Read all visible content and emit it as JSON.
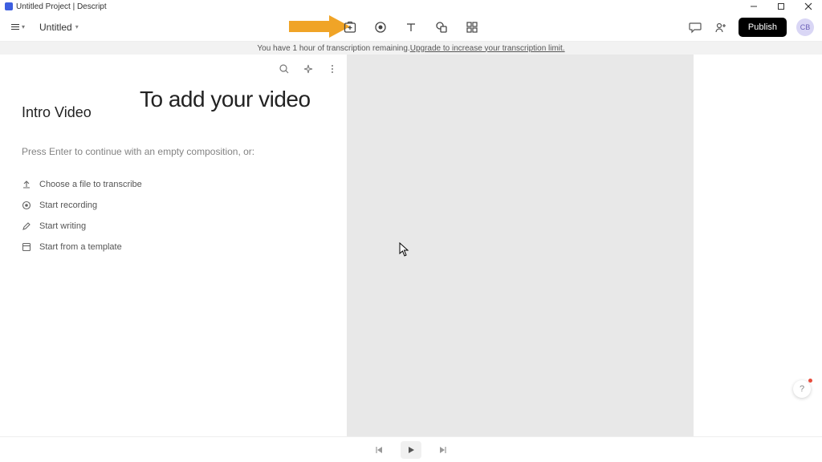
{
  "titlebar": {
    "title": "Untitled Project | Descript"
  },
  "toolbar": {
    "project_name": "Untitled",
    "publish_label": "Publish",
    "avatar_initials": "CB"
  },
  "banner": {
    "text": "You have 1 hour of transcription remaining. ",
    "link": "Upgrade to increase your transcription limit."
  },
  "script": {
    "heading": "To add your video",
    "composition_title": "Intro Video",
    "hint": "Press Enter to continue with an empty composition, or:",
    "options": [
      {
        "label": "Choose a file to transcribe"
      },
      {
        "label": "Start recording"
      },
      {
        "label": "Start writing"
      },
      {
        "label": "Start from a template"
      }
    ]
  },
  "help": {
    "label": "?"
  }
}
